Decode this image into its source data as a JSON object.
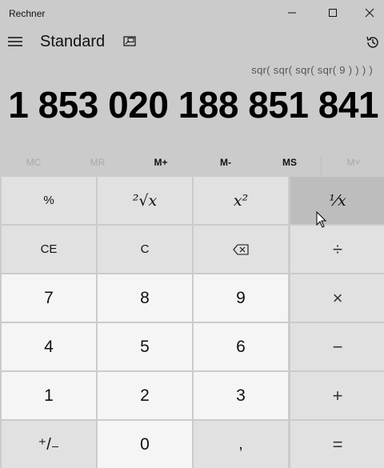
{
  "window": {
    "title": "Rechner",
    "controls": [
      "minimize-icon",
      "maximize-icon",
      "close-icon"
    ]
  },
  "header": {
    "mode": "Standard",
    "menu_icon": "hamburger-icon",
    "keep_on_top_icon": "keep-on-top-icon",
    "history_icon": "history-icon"
  },
  "display": {
    "expression": "sqr( sqr( sqr( sqr( 9 ) ) ) )",
    "result": "1 853 020 188 851 841"
  },
  "memory": [
    {
      "label": "MC",
      "enabled": false
    },
    {
      "label": "MR",
      "enabled": false
    },
    {
      "label": "M+",
      "enabled": true
    },
    {
      "label": "M-",
      "enabled": true
    },
    {
      "label": "MS",
      "enabled": true
    },
    {
      "label": "M˅",
      "enabled": false
    }
  ],
  "keys": {
    "percent": "%",
    "sqrt": "²√x",
    "square": "x²",
    "reciprocal": "¹⁄x",
    "ce": "CE",
    "c": "C",
    "backspace_icon": "backspace-icon",
    "divide": "÷",
    "seven": "7",
    "eight": "8",
    "nine": "9",
    "multiply": "×",
    "four": "4",
    "five": "5",
    "six": "6",
    "minus": "−",
    "one": "1",
    "two": "2",
    "three": "3",
    "plus": "+",
    "negate": "⁺/₋",
    "zero": "0",
    "decimal": ",",
    "equals": "="
  },
  "colors": {
    "background": "#cbcbcb",
    "function_key": "#e1e1e1",
    "number_key": "#f5f5f5",
    "hover_key": "#bdbdbd"
  }
}
